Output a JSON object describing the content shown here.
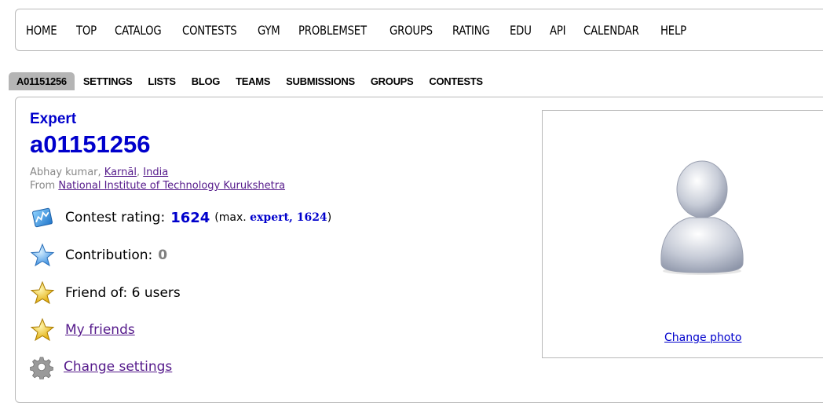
{
  "top_menu": {
    "items": [
      "HOME",
      "TOP",
      "CATALOG",
      "CONTESTS",
      "GYM",
      "PROBLEMSET",
      "GROUPS",
      "RATING",
      "EDU",
      "API",
      "CALENDAR",
      "HELP"
    ]
  },
  "second_menu": {
    "items": [
      "A01151256",
      "SETTINGS",
      "LISTS",
      "BLOG",
      "TEAMS",
      "SUBMISSIONS",
      "GROUPS",
      "CONTESTS"
    ]
  },
  "profile": {
    "rank": "Expert",
    "handle": "a01151256",
    "name": "Abhay kumar, ",
    "city": "Karnāl",
    "comma": ", ",
    "country": "India",
    "from_prefix": "From ",
    "organization": "National Institute of Technology Kurukshetra",
    "rating_label": "Contest rating:",
    "rating_value": "1624",
    "rating_max_prefix": "(max. ",
    "rating_max_rank": "expert, 1624",
    "rating_max_suffix": ")",
    "contribution_label": "Contribution:",
    "contribution_value": "0",
    "friend_of": "Friend of: 6 users",
    "my_friends": "My friends",
    "change_settings": "Change settings",
    "change_photo": "Change photo"
  },
  "icons": {
    "rating": "rating-chart-icon",
    "contribution": "blue-star-icon",
    "friend_of": "gold-star-icon",
    "my_friends": "gold-star-icon",
    "settings": "gear-icon",
    "avatar": "user-silhouette-icon"
  },
  "colors": {
    "expert": "#0000cc",
    "link": "#551a8b",
    "muted": "#888888"
  }
}
